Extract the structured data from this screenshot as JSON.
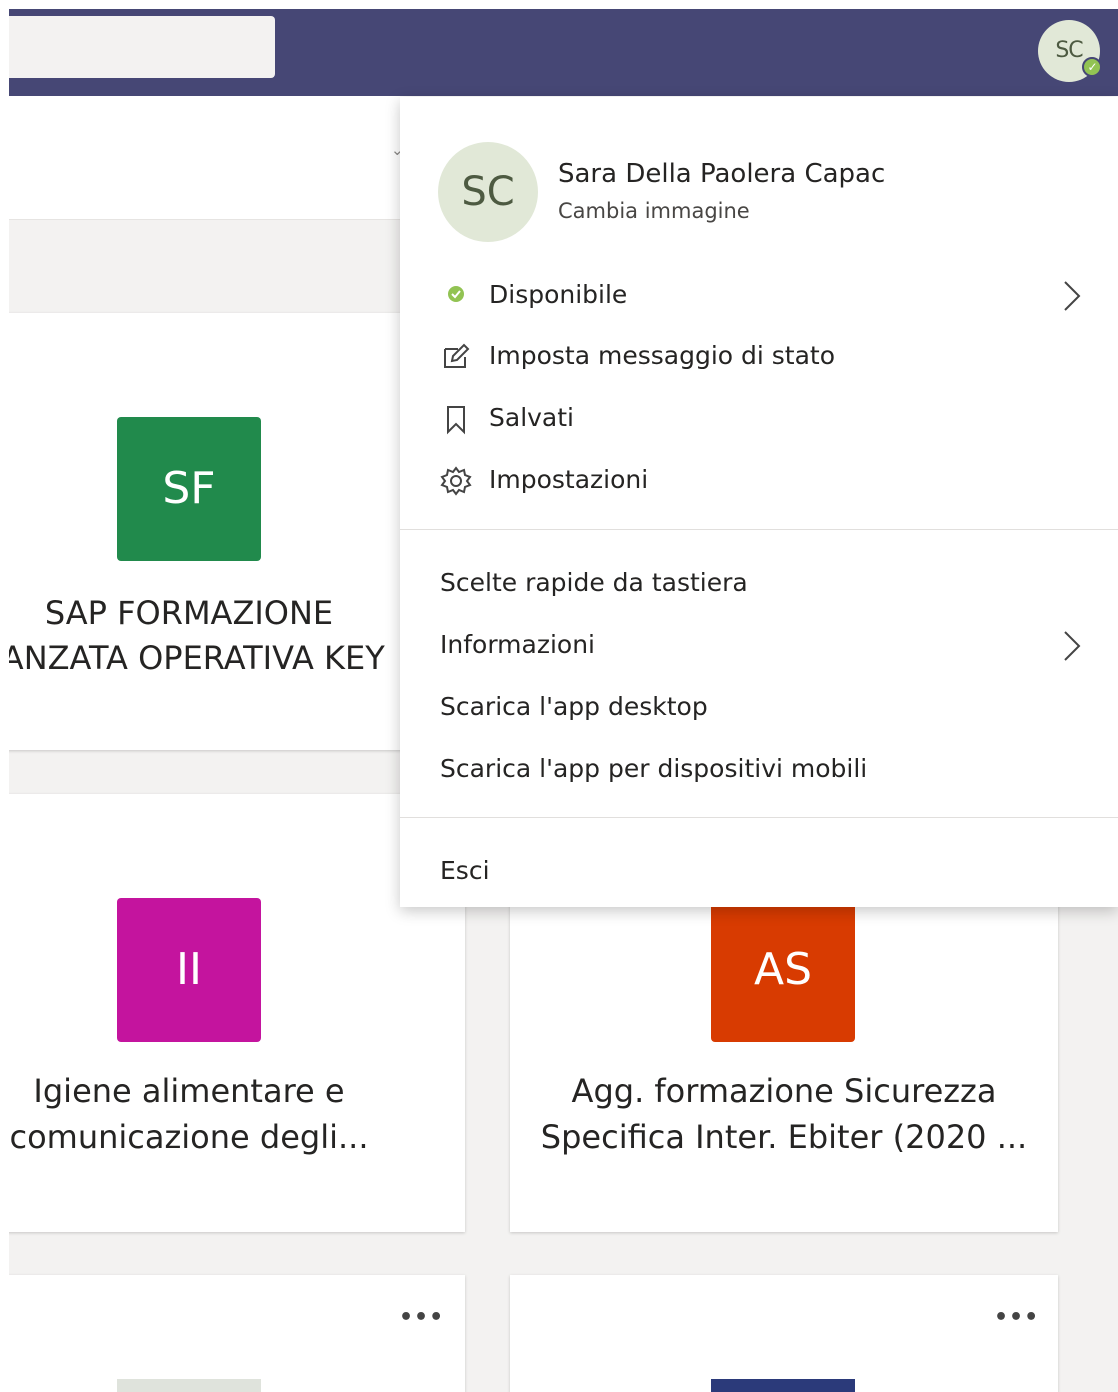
{
  "topbar": {
    "avatar_initials": "SC",
    "presence": "✓"
  },
  "cards": [
    {
      "initials": "SF",
      "color": "#218a4c",
      "title_line1": "SAP FORMAZIONE",
      "title_line2": "'ANZATA OPERATIVA KEY"
    },
    {
      "initials": "II",
      "color": "#c4149e",
      "title_line1": "Igiene alimentare e",
      "title_line2": "comunicazione degli..."
    },
    {
      "initials": "AS",
      "color": "#d83b01",
      "title_line1": "Agg. formazione Sicurezza",
      "title_line2": "Specifica Inter. Ebiter (2020 ..."
    }
  ],
  "more_label": "•••",
  "menu": {
    "avatar_initials": "SC",
    "user_name": "Sara Della Paolera Capac",
    "change_image": "Cambia immagine",
    "status": "Disponibile",
    "status_color": "#92c353",
    "set_status_message": "Imposta messaggio di stato",
    "saved": "Salvati",
    "settings": "Impostazioni",
    "shortcuts": "Scelte rapide da tastiera",
    "about": "Informazioni",
    "download_desktop": "Scarica l'app desktop",
    "download_mobile": "Scarica l'app per dispositivi mobili",
    "sign_out": "Esci"
  },
  "icons": {
    "edit": "edit-status-icon",
    "bookmark": "bookmark-icon",
    "settings": "gear-icon",
    "chevron": "chevron-right-icon"
  }
}
